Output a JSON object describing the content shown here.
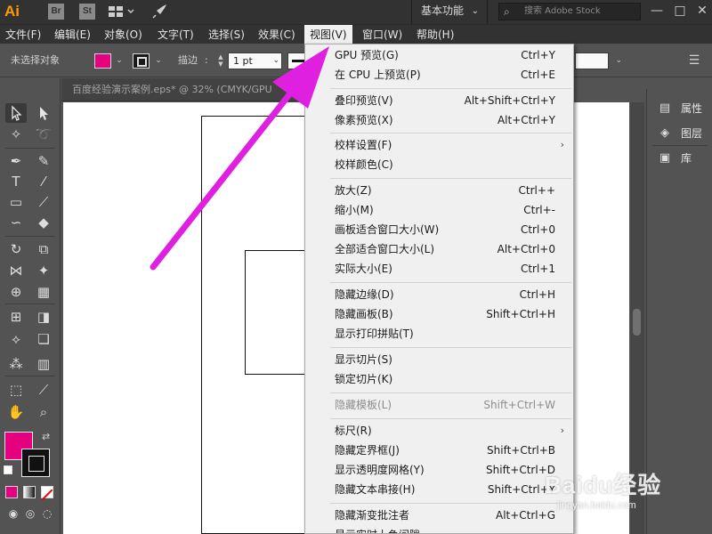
{
  "app": {
    "logo": "Ai",
    "bridge_label": "Br",
    "stock_label": "St",
    "workspace": "基本功能",
    "search_placeholder": "搜索 Adobe Stock",
    "window_controls": [
      "minimize-icon",
      "maximize-icon",
      "close-icon"
    ]
  },
  "menubar": {
    "items": [
      "文件(F)",
      "编辑(E)",
      "对象(O)",
      "文字(T)",
      "选择(S)",
      "效果(C)",
      "视图(V)",
      "窗口(W)",
      "帮助(H)"
    ],
    "active": "视图(V)"
  },
  "controlbar": {
    "selection_status": "未选择对象",
    "stroke_label": "描边",
    "stroke_weight": "1 pt",
    "fill_color": "#e5007e",
    "stroke_color": "#1a1a1a"
  },
  "document": {
    "tab_title": "百度经验演示案例.eps* @ 32% (CMYK/GPU"
  },
  "view_menu": {
    "groups": [
      [
        {
          "label": "GPU 预览(G)",
          "shortcut": "Ctrl+Y"
        },
        {
          "label": "在 CPU 上预览(P)",
          "shortcut": "Ctrl+E"
        }
      ],
      [
        {
          "label": "叠印预览(V)",
          "shortcut": "Alt+Shift+Ctrl+Y"
        },
        {
          "label": "像素预览(X)",
          "shortcut": "Alt+Ctrl+Y"
        }
      ],
      [
        {
          "label": "校样设置(F)",
          "shortcut": "",
          "submenu": true
        },
        {
          "label": "校样颜色(C)",
          "shortcut": ""
        }
      ],
      [
        {
          "label": "放大(Z)",
          "shortcut": "Ctrl++"
        },
        {
          "label": "缩小(M)",
          "shortcut": "Ctrl+-"
        },
        {
          "label": "画板适合窗口大小(W)",
          "shortcut": "Ctrl+0"
        },
        {
          "label": "全部适合窗口大小(L)",
          "shortcut": "Alt+Ctrl+0"
        },
        {
          "label": "实际大小(E)",
          "shortcut": "Ctrl+1"
        }
      ],
      [
        {
          "label": "隐藏边缘(D)",
          "shortcut": "Ctrl+H"
        },
        {
          "label": "隐藏画板(B)",
          "shortcut": "Shift+Ctrl+H"
        },
        {
          "label": "显示打印拼贴(T)",
          "shortcut": ""
        }
      ],
      [
        {
          "label": "显示切片(S)",
          "shortcut": ""
        },
        {
          "label": "锁定切片(K)",
          "shortcut": ""
        }
      ],
      [
        {
          "label": "隐藏模板(L)",
          "shortcut": "Shift+Ctrl+W",
          "disabled": true
        }
      ],
      [
        {
          "label": "标尺(R)",
          "shortcut": "",
          "submenu": true
        },
        {
          "label": "隐藏定界框(J)",
          "shortcut": "Shift+Ctrl+B"
        },
        {
          "label": "显示透明度网格(Y)",
          "shortcut": "Shift+Ctrl+D"
        },
        {
          "label": "隐藏文本串接(H)",
          "shortcut": "Shift+Ctrl+Y"
        }
      ],
      [
        {
          "label": "隐藏渐变批注者",
          "shortcut": "Alt+Ctrl+G"
        },
        {
          "label": "显示实时上色间隙",
          "shortcut": ""
        }
      ]
    ]
  },
  "right_panels": {
    "items": [
      {
        "icon": "properties-icon",
        "label": "属性"
      },
      {
        "icon": "layers-icon",
        "label": "图层"
      },
      {
        "icon": "libraries-icon",
        "label": "库"
      }
    ]
  },
  "watermark": {
    "brand": "Baidu经验",
    "url": "jingyan.baidu.com"
  },
  "annotation": {
    "arrow_color": "#e020e0"
  }
}
